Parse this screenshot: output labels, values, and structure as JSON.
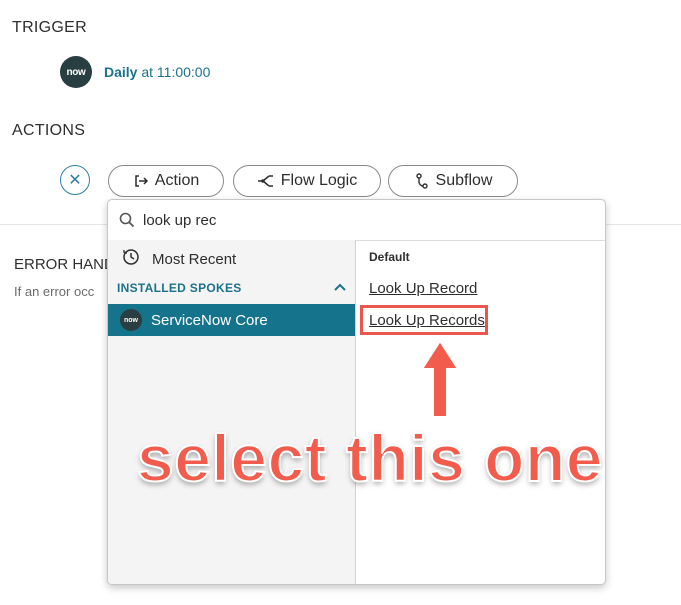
{
  "trigger": {
    "title": "TRIGGER",
    "logo_text": "now",
    "schedule_name": "Daily",
    "schedule_time": " at 11:00:00"
  },
  "actions": {
    "title": "ACTIONS",
    "buttons": [
      {
        "label": "Action",
        "icon": "action-icon"
      },
      {
        "label": "Flow Logic",
        "icon": "flow-logic-icon"
      },
      {
        "label": "Subflow",
        "icon": "subflow-icon"
      }
    ]
  },
  "error_handler": {
    "title": "ERROR HAND",
    "subtitle": "If an error occ"
  },
  "dropdown": {
    "search_value": "look up rec",
    "most_recent_label": "Most Recent",
    "spokes_header": "INSTALLED SPOKES",
    "selected_spoke": "ServiceNow Core",
    "spoke_logo_text": "now",
    "group_label": "Default",
    "results": [
      "Look Up Record",
      "Look Up Records"
    ]
  },
  "annotation": {
    "text": "select this one"
  },
  "colors": {
    "accent": "#1c7289",
    "selected_row": "#15738b",
    "annotation": "#f25c4c"
  }
}
